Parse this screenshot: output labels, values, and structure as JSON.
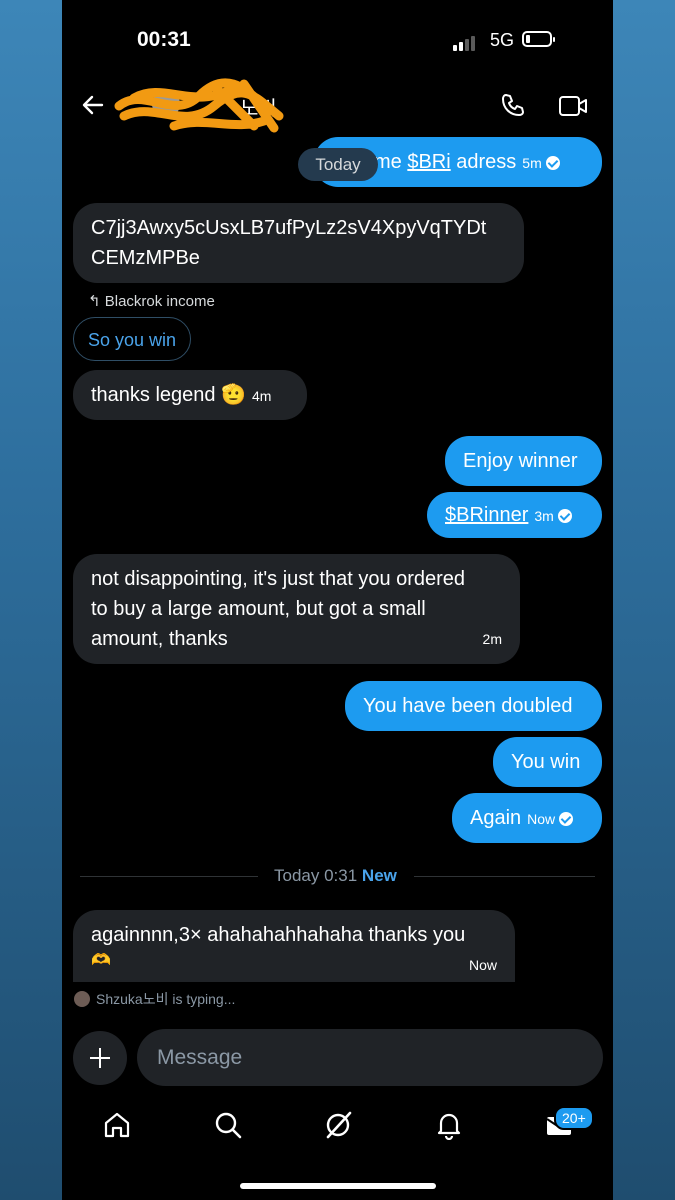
{
  "status": {
    "time": "00:31",
    "network": "5G"
  },
  "header": {
    "name_visible": "비",
    "name_fragment": "노비"
  },
  "today_pill": "Today",
  "messages": {
    "m1": {
      "text_prefix": "me ",
      "link": "$BRi",
      "text_suffix": " adress",
      "time": "5m"
    },
    "m2": {
      "line1": "C7jj3Awxy5cUsxLB7ufPyLz2sV4XpyVqTYDt",
      "line2": "CEMzMPBe"
    },
    "reply_note": "Blackrok income",
    "reply_quote": "So you win",
    "m3": {
      "text": "thanks legend",
      "emoji": "🫡",
      "time": "4m"
    },
    "m4": {
      "text": "Enjoy winner"
    },
    "m5": {
      "link": "$BRinner",
      "time": "3m"
    },
    "m6": {
      "line1": "not disappointing, it's just that you ordered",
      "line2": "to buy a large amount, but got a small",
      "line3": "amount, thanks",
      "time": "2m"
    },
    "m7": {
      "text": "You have been doubled"
    },
    "m8": {
      "text": "You win"
    },
    "m9": {
      "text": "Again",
      "time": "Now"
    },
    "divider": {
      "text": "Today 0:31",
      "new": "New"
    },
    "m10": {
      "line1": "againnnn,3× ahahahahhahaha thanks you",
      "emoji": "🫶",
      "time": "Now"
    }
  },
  "typing": "Shzuka노비 is typing...",
  "composer": {
    "placeholder": "Message"
  },
  "nav": {
    "badge": "20+"
  },
  "colors": {
    "accent": "#1d9bf0",
    "incoming": "#202327",
    "background": "#000000"
  }
}
